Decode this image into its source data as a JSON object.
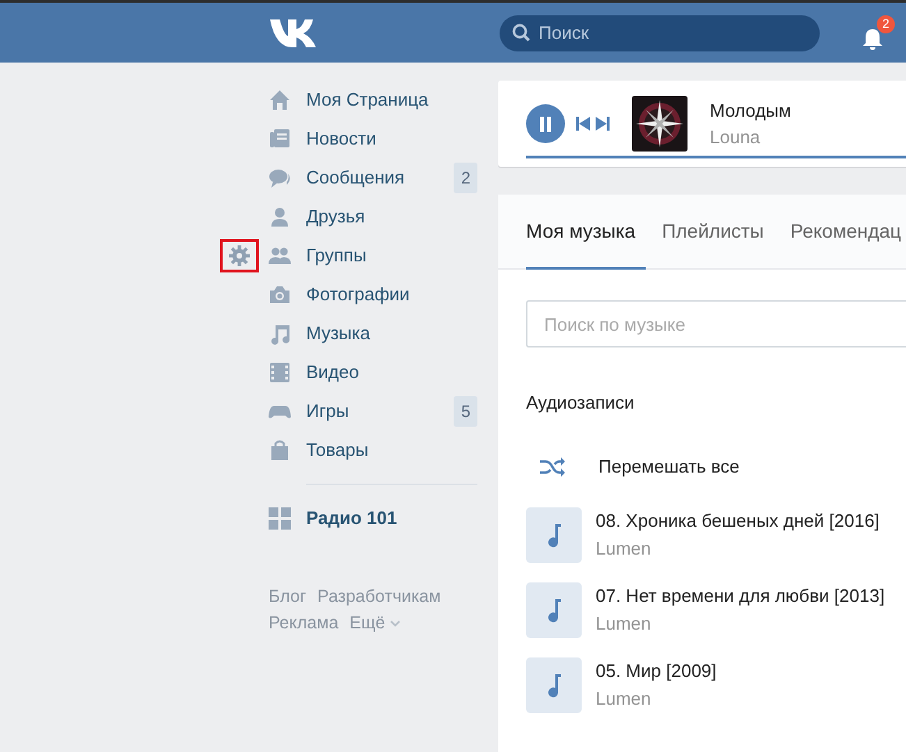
{
  "header": {
    "search": {
      "placeholder": "Поиск"
    },
    "notifications": {
      "count": "2"
    }
  },
  "sidebar": {
    "items": [
      {
        "label": "Моя Страница",
        "settings": false
      },
      {
        "label": "Новости",
        "settings": false
      },
      {
        "label": "Сообщения",
        "count": "2",
        "settings": false
      },
      {
        "label": "Друзья",
        "settings": false
      },
      {
        "label": "Группы",
        "settings": true
      },
      {
        "label": "Фотографии",
        "settings": false
      },
      {
        "label": "Музыка",
        "settings": false
      },
      {
        "label": "Видео",
        "settings": false
      },
      {
        "label": "Игры",
        "count": "5",
        "settings": false
      },
      {
        "label": "Товары",
        "settings": false
      }
    ],
    "apps": [
      {
        "label": "Радио 101"
      }
    ],
    "footer_links": [
      [
        "Блог",
        "Разработчикам"
      ],
      [
        "Реклама",
        "Ещё"
      ]
    ]
  },
  "player": {
    "playing": true,
    "title": "Молодым",
    "artist": "Louna"
  },
  "music": {
    "tabs": [
      {
        "label": "Моя музыка",
        "selected": true
      },
      {
        "label": "Плейлисты",
        "selected": false
      },
      {
        "label": "Рекомендац",
        "selected": false
      }
    ],
    "search": {
      "placeholder": "Поиск по музыке"
    },
    "section_title": "Аудиозаписи",
    "shuffle": "Перемешать все",
    "tracks": [
      {
        "title": "08. Хроника бешеных дней [2016]",
        "artist": "Lumen"
      },
      {
        "title": "07. Нет времени для любви [2013]",
        "artist": "Lumen"
      },
      {
        "title": "05. Мир [2009]",
        "artist": "Lumen"
      }
    ]
  }
}
